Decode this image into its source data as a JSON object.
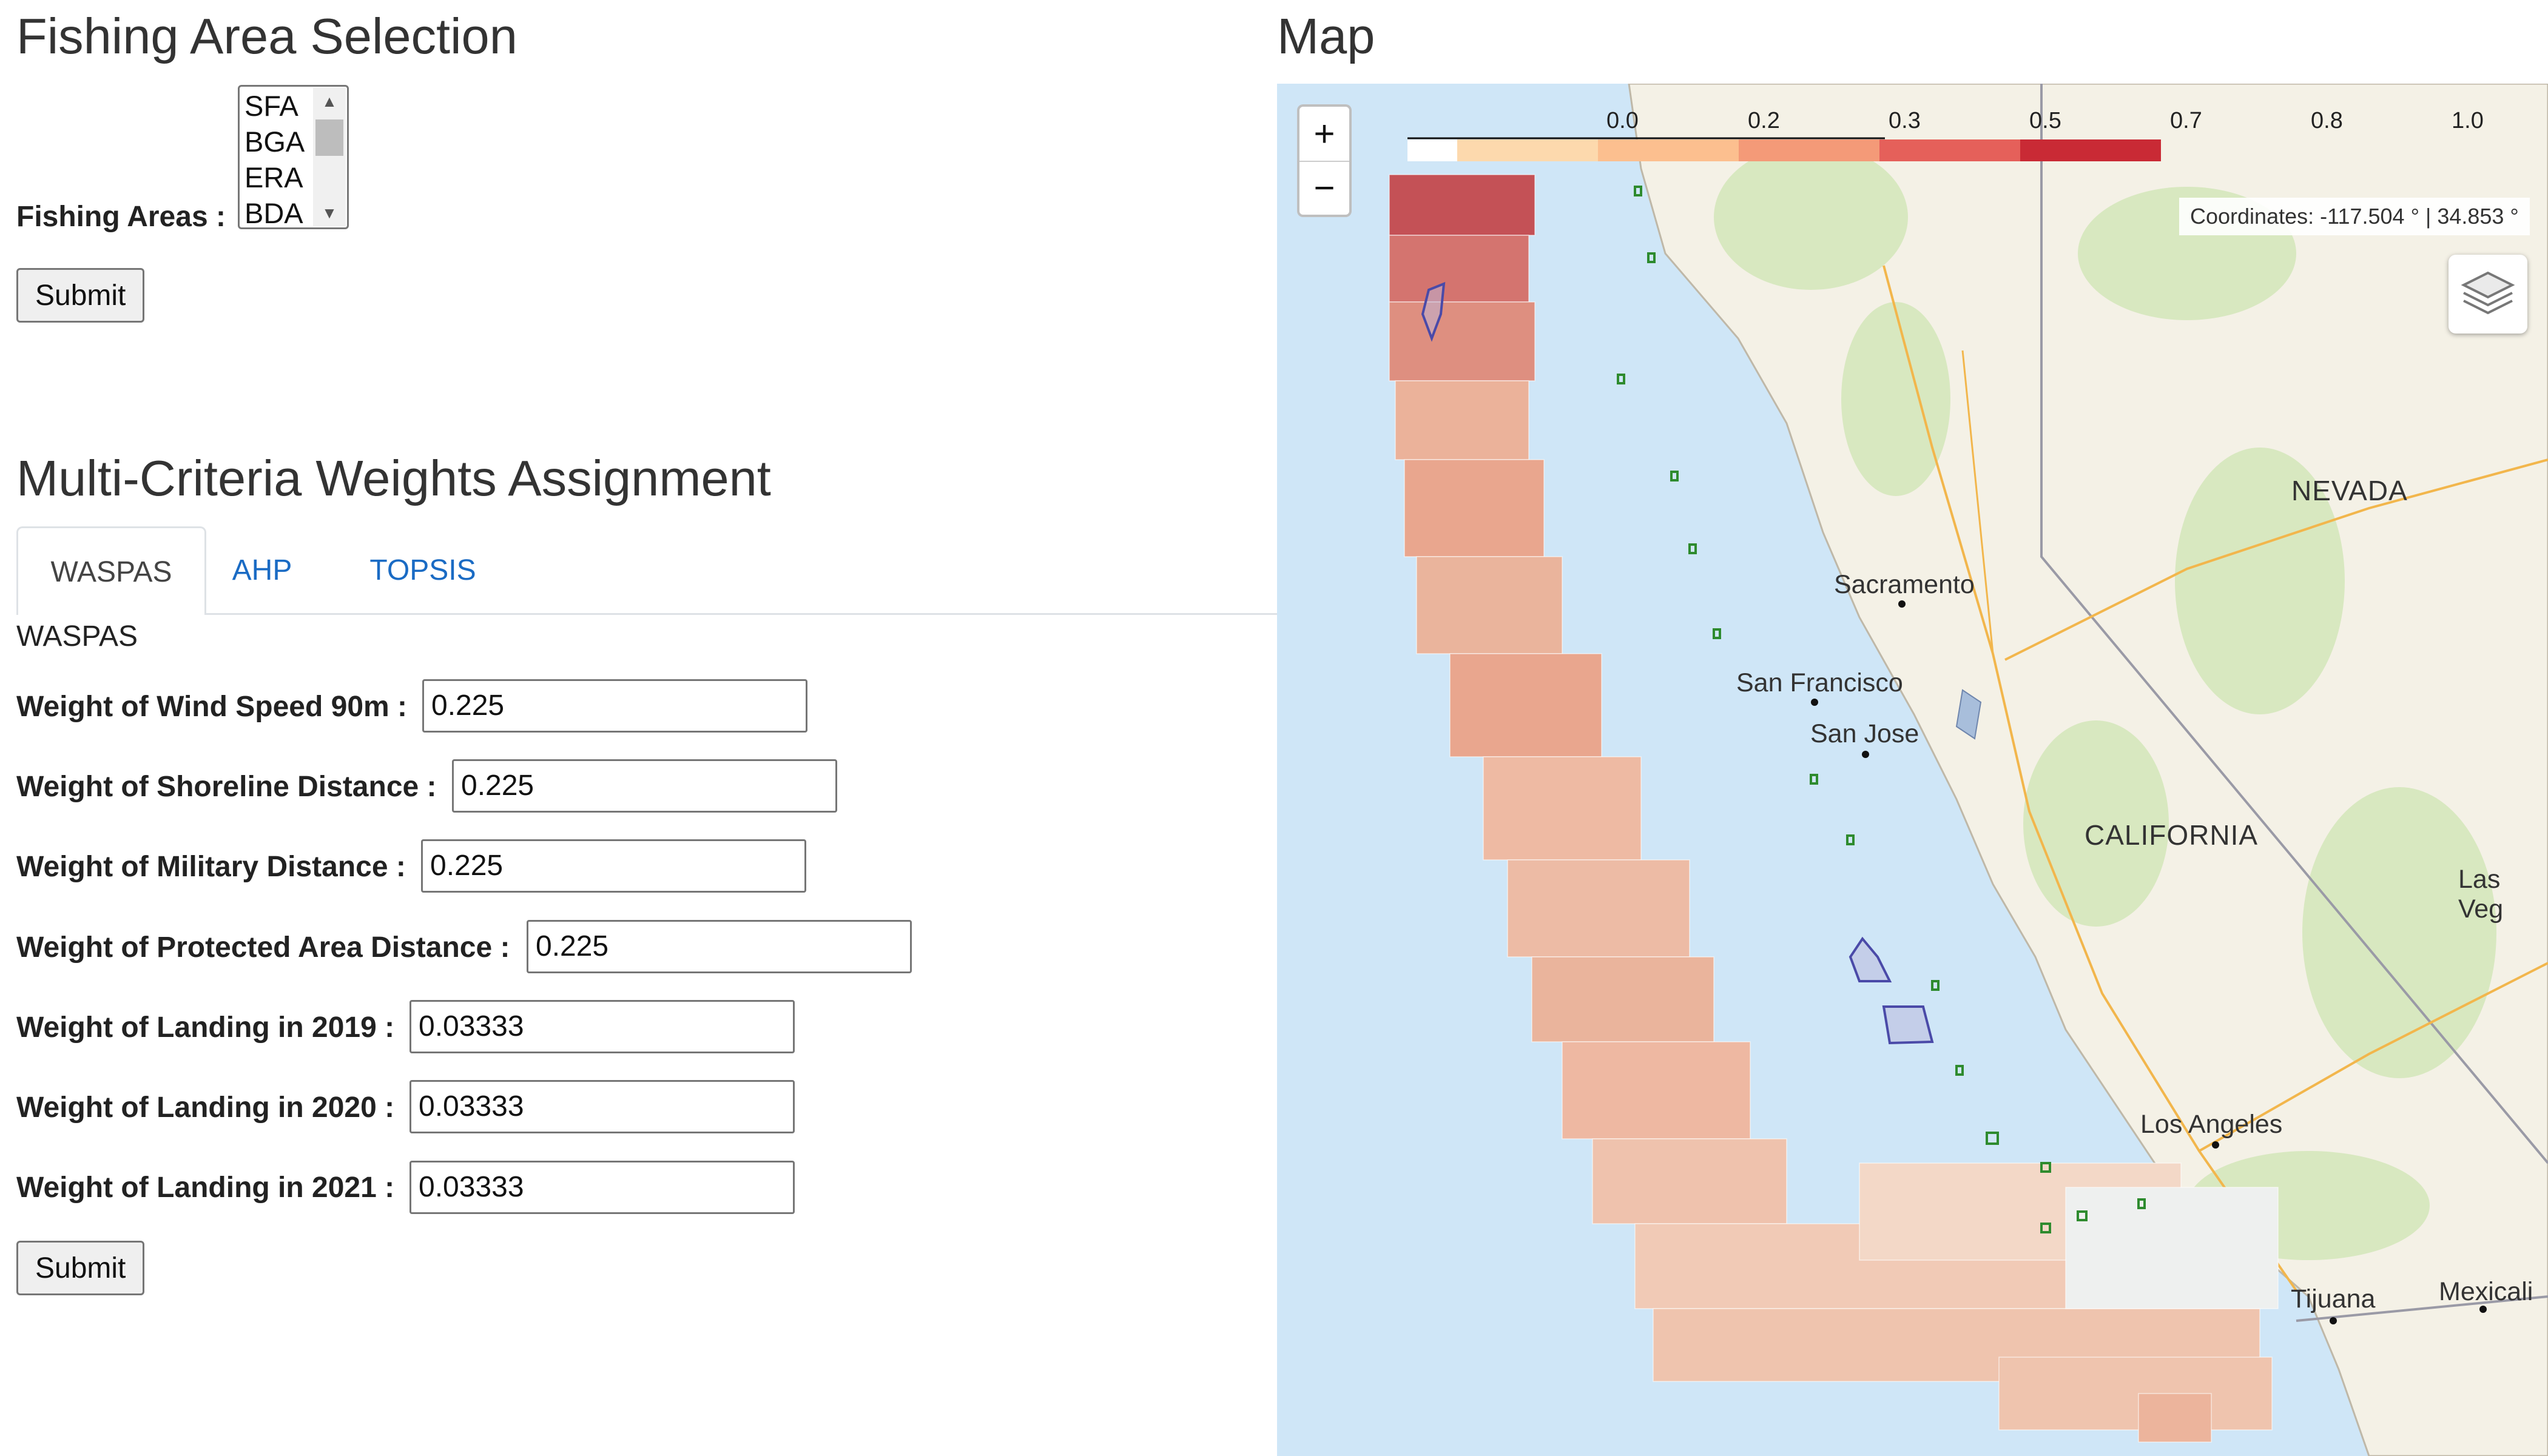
{
  "fishing_section": {
    "title": "Fishing Area Selection",
    "label": "Fishing Areas :",
    "options": [
      "SFA",
      "BGA",
      "ERA",
      "BDA"
    ],
    "submit_label": "Submit"
  },
  "weights_section": {
    "title": "Multi-Criteria Weights Assignment",
    "tabs": [
      "WASPAS",
      "AHP",
      "TOPSIS"
    ],
    "active_tab": "WASPAS",
    "panel_title": "WASPAS",
    "fields": [
      {
        "label": "Weight of Wind Speed 90m :",
        "value": "0.225"
      },
      {
        "label": "Weight of Shoreline Distance :",
        "value": "0.225"
      },
      {
        "label": "Weight of Military Distance :",
        "value": "0.225"
      },
      {
        "label": "Weight of Protected Area Distance :",
        "value": "0.225"
      },
      {
        "label": "Weight of Landing in 2019 :",
        "value": "0.03333"
      },
      {
        "label": "Weight of Landing in 2020 :",
        "value": "0.03333"
      },
      {
        "label": "Weight of Landing in 2021 :",
        "value": "0.03333"
      }
    ],
    "submit_label": "Submit"
  },
  "map": {
    "title": "Map",
    "zoom_in": "+",
    "zoom_out": "−",
    "coordinates": "Coordinates: -117.504 ° | 34.853 °",
    "legend": {
      "ticks": [
        "0.0",
        "0.2",
        "0.3",
        "0.5",
        "0.7",
        "0.8",
        "1.0"
      ],
      "colors": [
        "#ffffff",
        "#fdd9ad",
        "#fcbf8f",
        "#f49a78",
        "#e5605a",
        "#c92a35"
      ]
    },
    "places": {
      "nevada": "NEVADA",
      "sacramento": "Sacramento",
      "san_francisco": "San Francisco",
      "san_jose": "San Jose",
      "california": "CALIFORNIA",
      "las_vegas": "Las Veg",
      "los_angeles": "Los Angeles",
      "tijuana": "Tijuana",
      "mexicali": "Mexicali"
    },
    "colors": {
      "ocean": "#cfe6f7",
      "land": "#f4f1e6",
      "vegetation": "#d8e8c0",
      "protected_outline": "#2e8b2e",
      "military_outline": "#4a4aa8"
    }
  }
}
